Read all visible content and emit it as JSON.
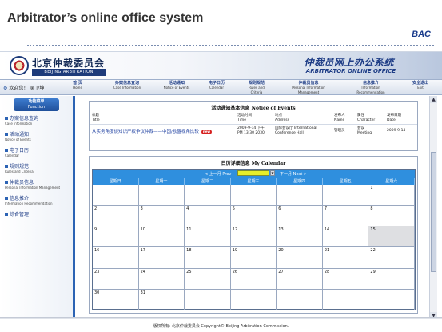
{
  "slide": {
    "title": "Arbitrator’s online office system",
    "brand": "BAC"
  },
  "banner": {
    "logo_cn": "北京仲裁委员会",
    "logo_en": "BEIJING ARBITRATION COMMISSION",
    "system_cn": "仲裁员网上办公系统",
    "system_en": "ARBITRATOR ONLINE OFFICE"
  },
  "navbar": {
    "welcome_label": "欢迎您！",
    "user_name": "吴卫坤",
    "items": [
      {
        "cn": "首 页",
        "en": "Home"
      },
      {
        "cn": "办案信息查询",
        "en": "Case Information"
      },
      {
        "cn": "活动通知",
        "en": "Notice of Events"
      },
      {
        "cn": "电子日历",
        "en": "Calendar"
      },
      {
        "cn": "规则规范",
        "en": "Rules and Criteria"
      },
      {
        "cn": "仲裁员信息",
        "en": "Personal Information Management"
      },
      {
        "cn": "信息推介",
        "en": "Information Recommendation"
      },
      {
        "cn": "安全退出",
        "en": "Exit"
      }
    ]
  },
  "sidebar": {
    "active": {
      "cn": "功能菜单",
      "en": "Function"
    },
    "items": [
      {
        "cn": "办案信息查询",
        "en": "Case Information"
      },
      {
        "cn": "活动通知",
        "en": "Notice of Events"
      },
      {
        "cn": "电子日历",
        "en": "Calendar"
      },
      {
        "cn": "规则规范",
        "en": "Rules and Criteria"
      },
      {
        "cn": "仲裁员信息",
        "en": "Personal Information Management"
      },
      {
        "cn": "信息推介",
        "en": "Information Recommendation"
      },
      {
        "cn": "综合管理",
        "en": ""
      }
    ]
  },
  "notice": {
    "title": "活动通知基本信息 Notice of Events",
    "headers": [
      {
        "cn": "标题",
        "en": "Title"
      },
      {
        "cn": "活动时间",
        "en": "Time"
      },
      {
        "cn": "地点",
        "en": "Address"
      },
      {
        "cn": "发布人",
        "en": "Name"
      },
      {
        "cn": "属性",
        "en": "Character"
      },
      {
        "cn": "发布日期",
        "en": "Date"
      }
    ],
    "row": {
      "title": "从实务角度谈知识产权争议仲裁——中国/欧盟视角比较",
      "badge": "new",
      "time_line1": "2009-9-14 下午",
      "time_line2": "PM 13:30 2030",
      "address_line1": "国际会议厅 International",
      "address_line2": "Conference Hall",
      "name": "管理员",
      "character_line1": "会议",
      "character_line2": "Meeting",
      "date": "2009-9-14"
    }
  },
  "calendar": {
    "title": "日历详细信息 My Calendar",
    "prev_label": "< 上一月 Prev",
    "selected_month": "",
    "next_label": "下一月 Next >",
    "weekdays": [
      "星期日",
      "星期一",
      "星期二",
      "星期三",
      "星期四",
      "星期五",
      "星期六"
    ],
    "days": [
      "",
      "",
      "",
      "",
      "",
      "",
      "1",
      "2",
      "3",
      "4",
      "5",
      "6",
      "7",
      "8",
      "9",
      "10",
      "11",
      "12",
      "13",
      "14",
      "15",
      "16",
      "17",
      "18",
      "19",
      "20",
      "21",
      "22",
      "23",
      "24",
      "25",
      "26",
      "27",
      "28",
      "29",
      "30",
      "31",
      "",
      "",
      "",
      "",
      ""
    ],
    "today_index": 20
  },
  "footer": {
    "text": "版权所有: 北京仲裁委员会 Copyright© Beijing Arbitration Commission."
  },
  "colors": {
    "nav_blue": "#1e3d86",
    "calendar_header": "#2f8fde",
    "month_select": "#e6ee2b",
    "sidebar_accent": "#2c63b4"
  }
}
